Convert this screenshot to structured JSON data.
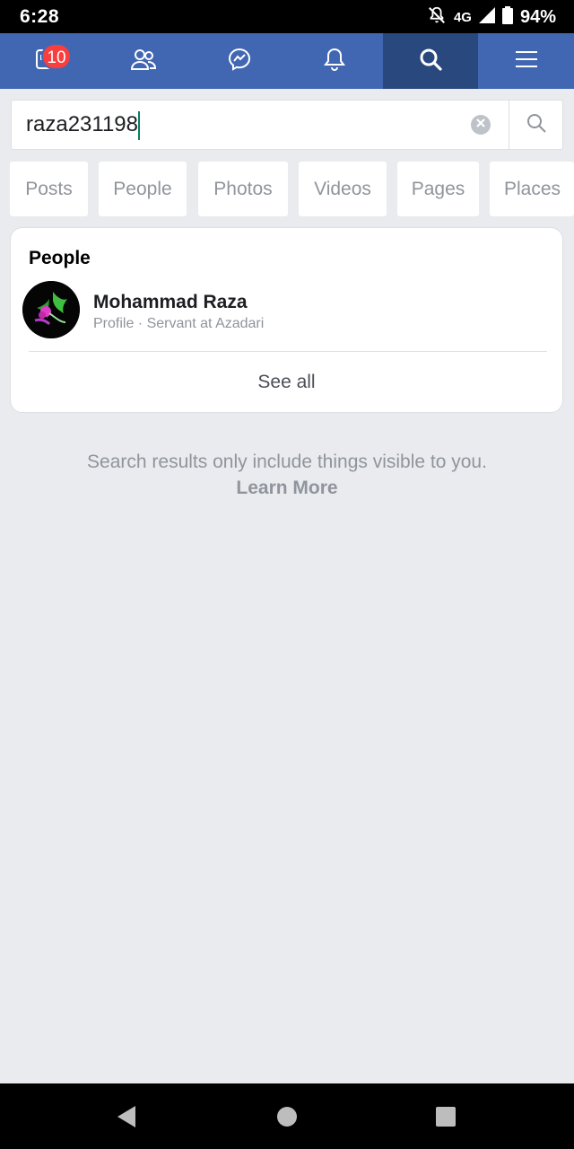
{
  "status_bar": {
    "time": "6:28",
    "network": "4G",
    "battery": "94%",
    "icons": [
      "notifications-off-icon",
      "signal-icon",
      "battery-icon"
    ]
  },
  "top_nav": {
    "items": [
      {
        "name": "news-feed",
        "icon": "news-feed-icon",
        "badge": "10"
      },
      {
        "name": "friends",
        "icon": "friends-icon"
      },
      {
        "name": "messenger",
        "icon": "messenger-icon"
      },
      {
        "name": "notifications",
        "icon": "bell-icon"
      },
      {
        "name": "search",
        "icon": "search-icon",
        "active": true
      },
      {
        "name": "menu",
        "icon": "hamburger-menu-icon"
      }
    ],
    "background": "#4267b2",
    "active_background": "#29487d"
  },
  "search": {
    "value": "raza231198",
    "clear_icon": "clear-icon",
    "submit_icon": "search-icon"
  },
  "filters": [
    "Posts",
    "People",
    "Photos",
    "Videos",
    "Pages",
    "Places"
  ],
  "results": {
    "section_title": "People",
    "items": [
      {
        "name": "Mohammad Raza",
        "subtitle": "Profile · Servant at Azadari",
        "avatar": "avatar"
      }
    ],
    "see_all": "See all"
  },
  "footer": {
    "note": "Search results only include things visible to you.",
    "link": "Learn More"
  },
  "android_nav": {
    "icons": [
      "back-icon",
      "home-icon",
      "recents-icon"
    ]
  }
}
